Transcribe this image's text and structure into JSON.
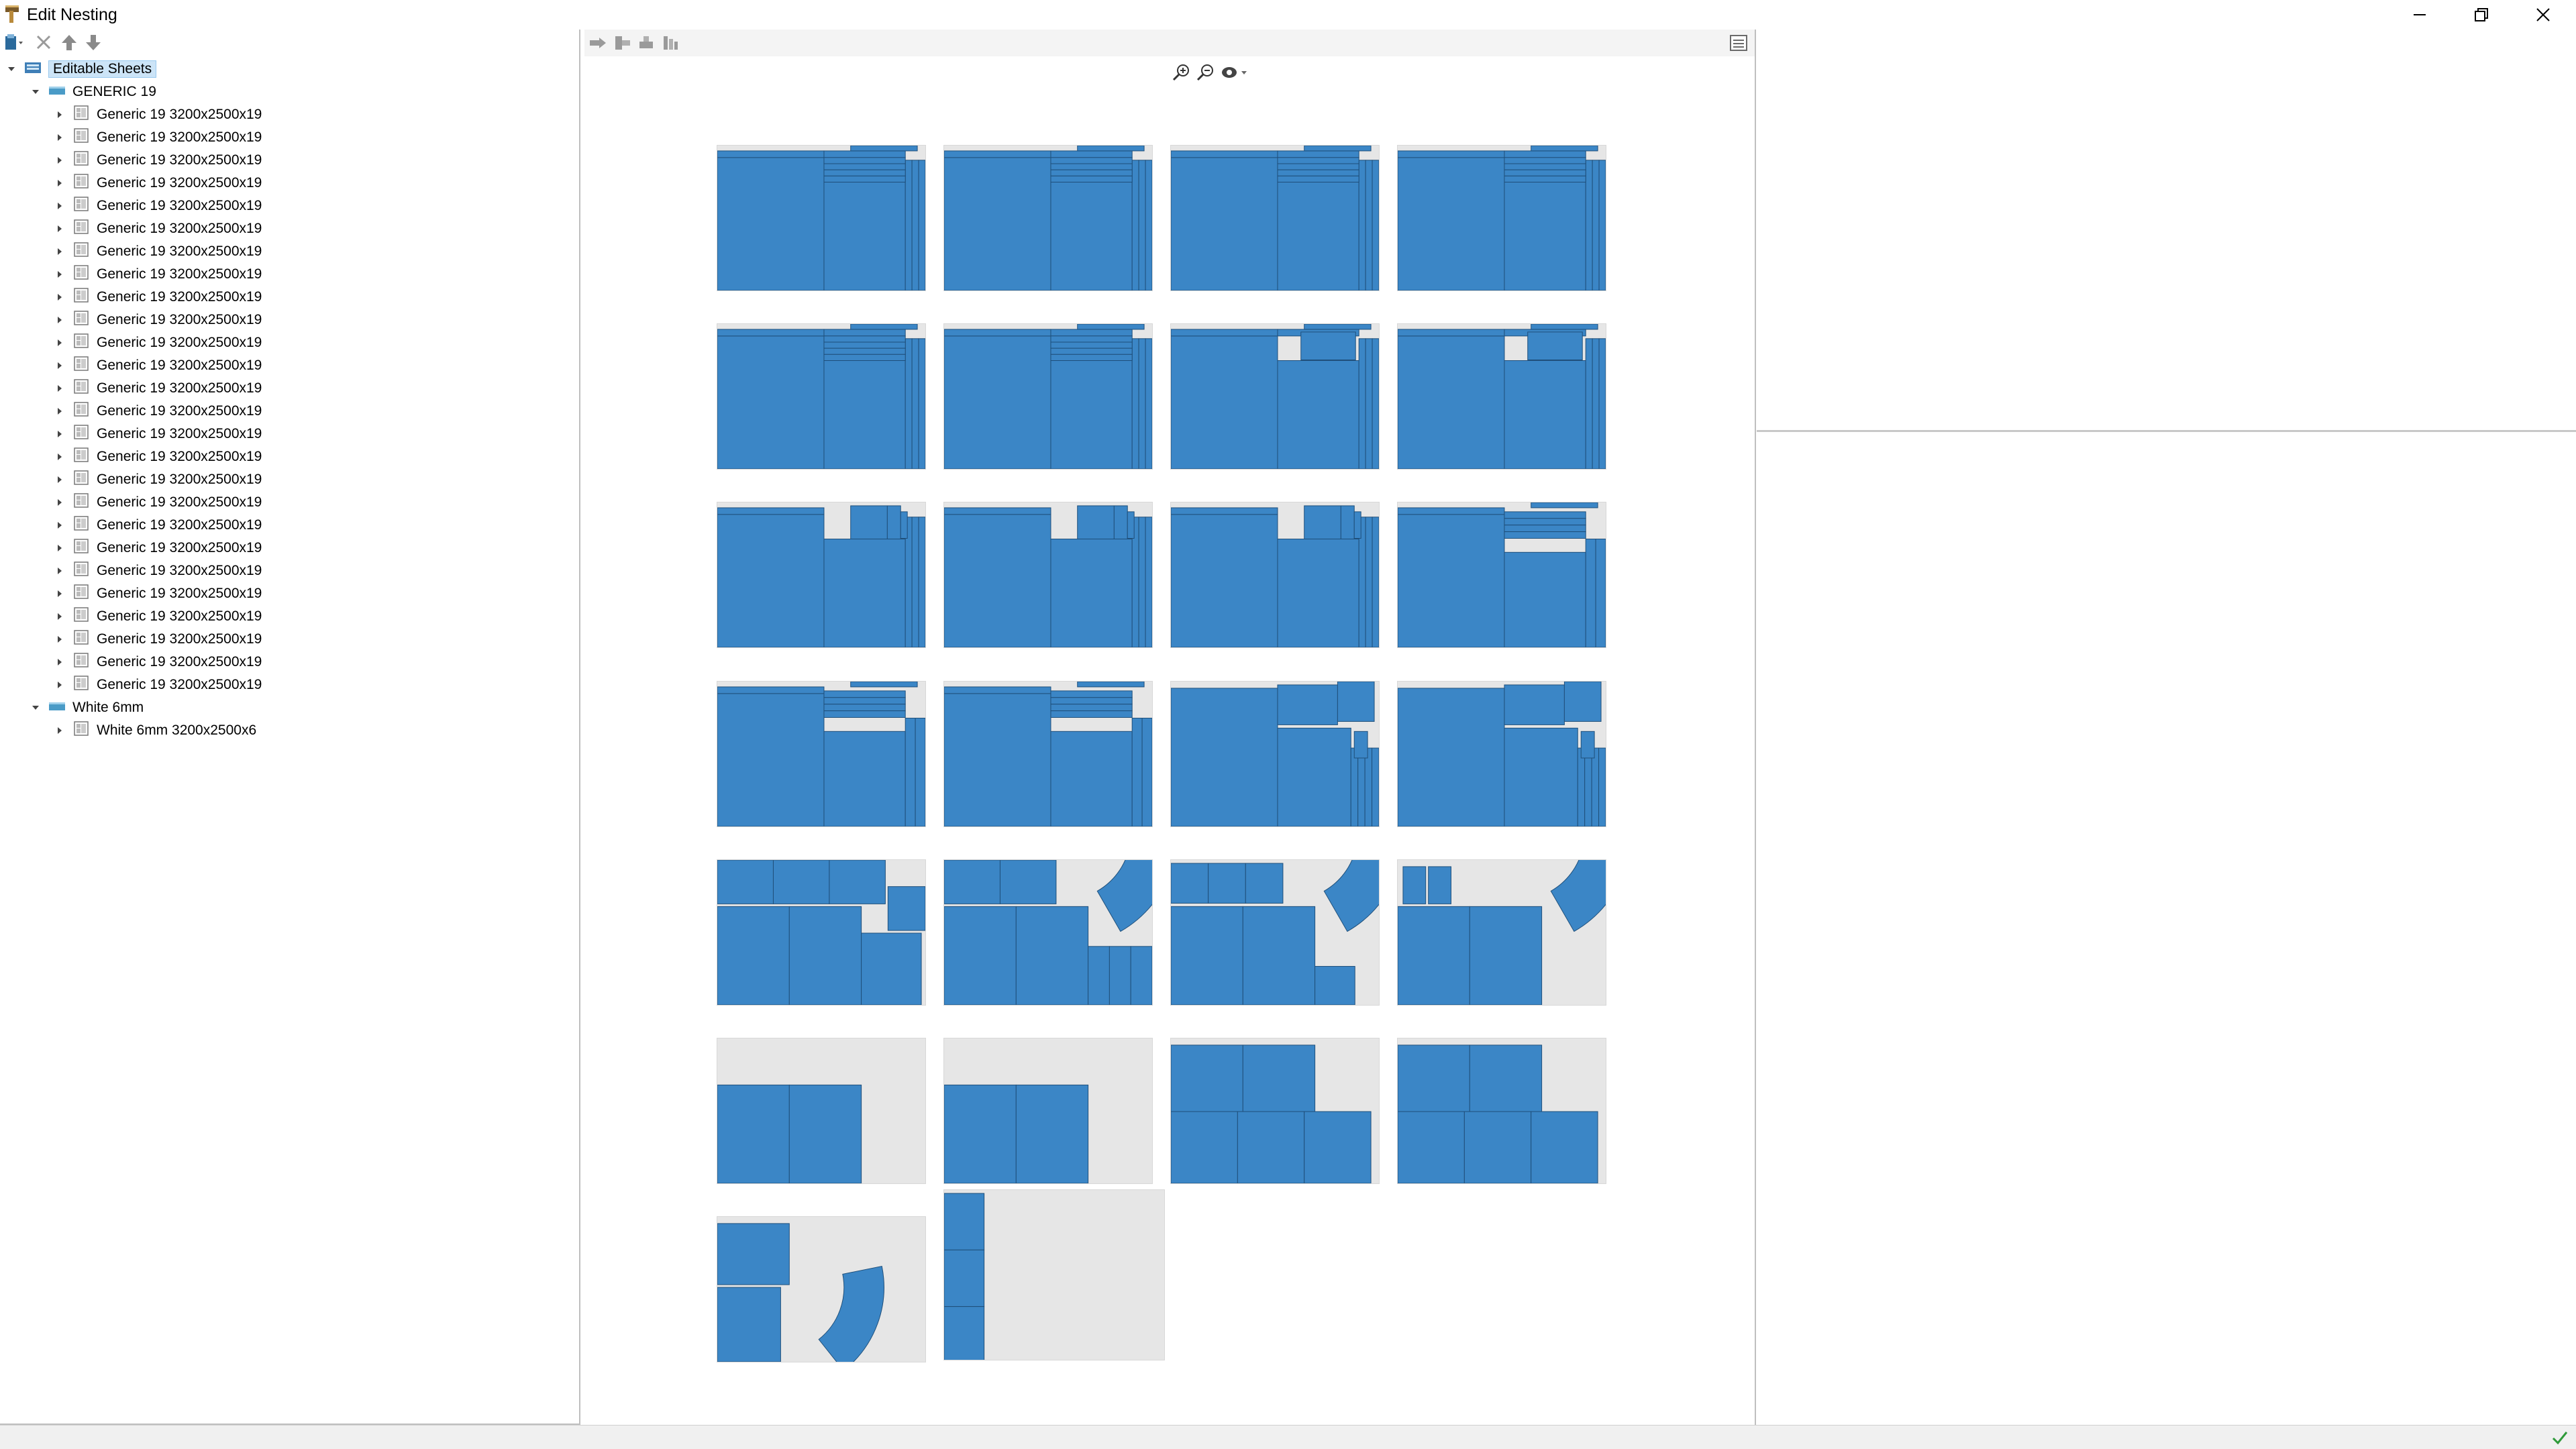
{
  "window": {
    "title": "Edit Nesting",
    "icons": {
      "app": "nesting-app-icon",
      "minimize": "minimize-icon",
      "restore": "restore-icon",
      "close": "close-icon"
    }
  },
  "tree_toolbar": {
    "icons": [
      "add-sheet-icon",
      "delete-icon",
      "move-up-icon",
      "move-down-icon"
    ]
  },
  "tree": {
    "root": {
      "label": "Editable Sheets",
      "icon": "sheets-folder-icon"
    },
    "groups": [
      {
        "label": "GENERIC 19",
        "icon": "material-icon",
        "items": [
          "Generic 19 3200x2500x19",
          "Generic 19 3200x2500x19",
          "Generic 19 3200x2500x19",
          "Generic 19 3200x2500x19",
          "Generic 19 3200x2500x19",
          "Generic 19 3200x2500x19",
          "Generic 19 3200x2500x19",
          "Generic 19 3200x2500x19",
          "Generic 19 3200x2500x19",
          "Generic 19 3200x2500x19",
          "Generic 19 3200x2500x19",
          "Generic 19 3200x2500x19",
          "Generic 19 3200x2500x19",
          "Generic 19 3200x2500x19",
          "Generic 19 3200x2500x19",
          "Generic 19 3200x2500x19",
          "Generic 19 3200x2500x19",
          "Generic 19 3200x2500x19",
          "Generic 19 3200x2500x19",
          "Generic 19 3200x2500x19",
          "Generic 19 3200x2500x19",
          "Generic 19 3200x2500x19",
          "Generic 19 3200x2500x19",
          "Generic 19 3200x2500x19",
          "Generic 19 3200x2500x19",
          "Generic 19 3200x2500x19"
        ]
      },
      {
        "label": "White 6mm",
        "icon": "material-icon",
        "items": [
          "White 6mm 3200x2500x6"
        ]
      }
    ]
  },
  "center_toolbar": {
    "icons": [
      "arrange-right-icon",
      "arrange-left-icon",
      "align-bottom-icon",
      "align-distribute-icon",
      "view-list-icon"
    ]
  },
  "zoom_tools": {
    "icons": [
      "zoom-in-icon",
      "zoom-out-icon",
      "view-options-icon"
    ]
  },
  "colors": {
    "part": "#3b86c6",
    "sheet": "#e6e6e6",
    "part_border": "#1f4f7a"
  },
  "sheets_grid": {
    "count": 26,
    "columns": 4
  },
  "status": {
    "icon": "check-icon"
  }
}
